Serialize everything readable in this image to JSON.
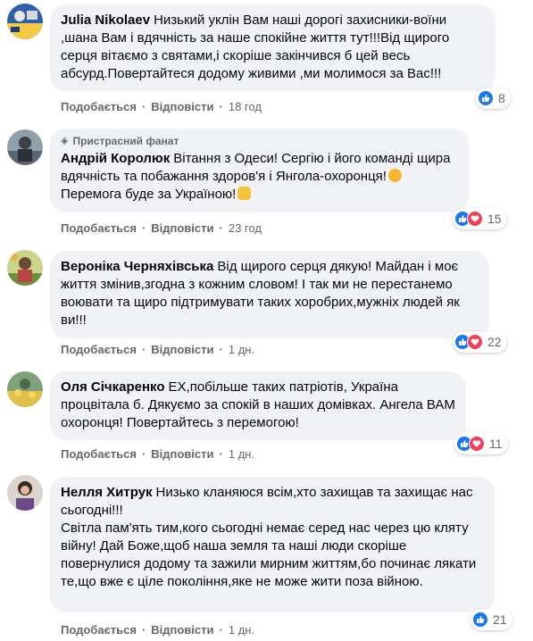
{
  "comments": [
    {
      "name": "Julia Nikolaev",
      "text": "Низький уклін Вам наші дорогі захисники-воїни ,шана Вам і вдячність за наше спокійне життя тут!!!Від щирого серця вітаємо з святами,і скоріше закінчився б цей весь абсурд.Повертайтеся додому живими ,ми молимося за Вас!!!",
      "like_label": "Подобається",
      "reply_label": "Відповісти",
      "time": "18 год",
      "reactions": [
        "like"
      ],
      "reaction_count": "8"
    },
    {
      "badge": "Пристрасний фанат",
      "name": "Андрій Королюк",
      "text": "Вітання з Одеси! Сергію і його команді щира вдячність та побажання здоров'я і Янгола-охоронця!",
      "text_end": "Перемога буде за Україною!",
      "like_label": "Подобається",
      "reply_label": "Відповісти",
      "time": "23 год",
      "reactions": [
        "like",
        "love"
      ],
      "reaction_count": "15"
    },
    {
      "name": "Вероніка Черняхівська",
      "text": "Від щирого серця дякую! Майдан і моє життя змінив,згодна з кожним словом! І так ми не перестанемо воювати та щиро підтримувати таких хоробрих,мужніх людей як ви!!!",
      "like_label": "Подобається",
      "reply_label": "Відповісти",
      "time": "1 дн.",
      "reactions": [
        "like",
        "love"
      ],
      "reaction_count": "22"
    },
    {
      "name": "Оля Січкаренко",
      "text": "ЕХ,побільше таких патріотів, Україна процвітала б. Дякуємо за спокій в наших домівках. Ангела ВАМ охоронця! Повертайтесь з перемогою!",
      "like_label": "Подобається",
      "reply_label": "Відповісти",
      "time": "1 дн.",
      "reactions": [
        "like",
        "love"
      ],
      "reaction_count": "11"
    },
    {
      "name": "Нелля Хитрук",
      "text": "Низько кланяюся всім,хто захищав та захищає нас сьогодні!!!\nСвітла пам'ять тим,кого сьогодні немає серед нас через цю кляту війну! Дай Боже,щоб наша земля та наші люди скоріше повернулися додому та зажили мирним життям,бо починає лякати те,що вже є ціле покоління,яке не може жити поза війною.",
      "like_label": "Подобається",
      "reply_label": "Відповісти",
      "time": "1 дн.",
      "reactions": [
        "like"
      ],
      "reaction_count": "21"
    }
  ],
  "colors": {
    "bubble": "#f0f2f5",
    "secondary_text": "#65676b",
    "like": "#1877f2",
    "love": "#f33e58"
  },
  "icons": {
    "like": "thumbs-up-icon",
    "love": "heart-icon",
    "badge": "diamond-icon",
    "emoji_1": "handshake-emoji",
    "emoji_2": "victory-hand-emoji"
  }
}
